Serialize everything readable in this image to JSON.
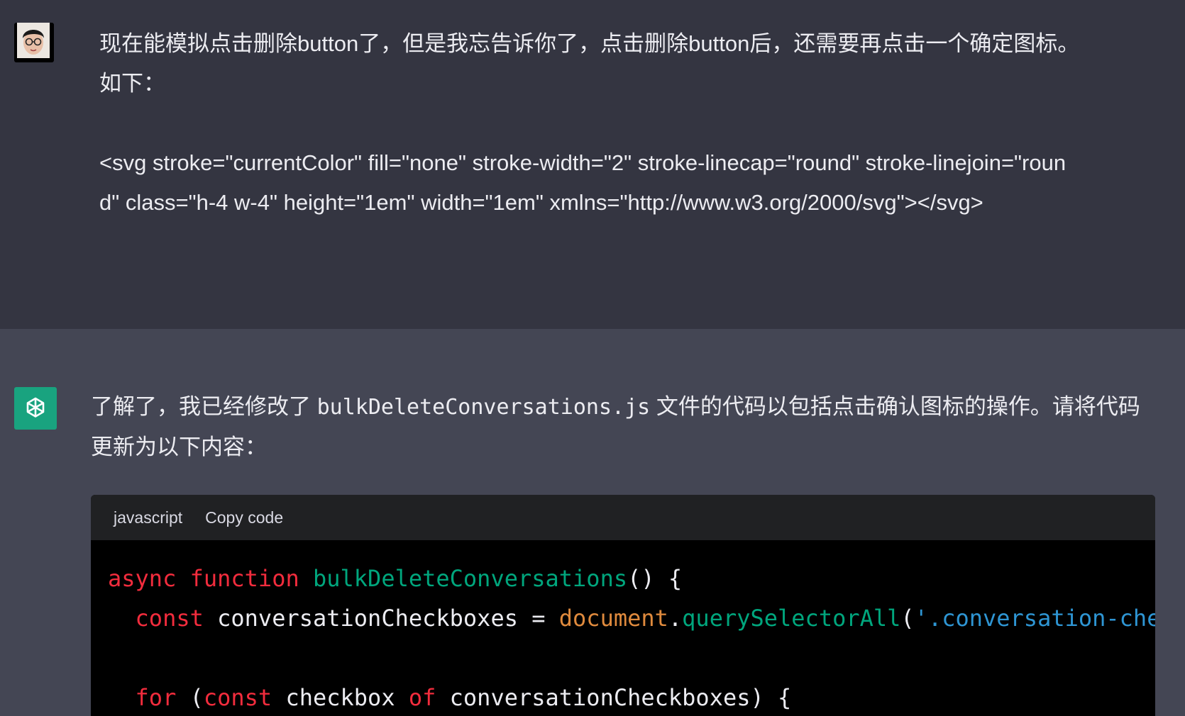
{
  "user_message": {
    "text": "现在能模拟点击删除button了，但是我忘告诉你了，点击删除button后，还需要再点击一个确定图标。如下：\n\n<svg stroke=\"currentColor\" fill=\"none\" stroke-width=\"2\" stroke-linecap=\"round\" stroke-linejoin=\"round\" class=\"h-4 w-4\" height=\"1em\" width=\"1em\" xmlns=\"http://www.w3.org/2000/svg\"></svg>"
  },
  "assistant_message": {
    "text_before": "了解了，我已经修改了 ",
    "filename": "bulkDeleteConversations.js",
    "text_after": " 文件的代码以包括点击确认图标的操作。请将代码更新为以下内容："
  },
  "code_block": {
    "language": "javascript",
    "copy_label": "Copy code",
    "lines": [
      [
        {
          "t": "kw",
          "v": "async"
        },
        {
          "t": "pl",
          "v": " "
        },
        {
          "t": "kw",
          "v": "function"
        },
        {
          "t": "pl",
          "v": " "
        },
        {
          "t": "fn",
          "v": "bulkDeleteConversations"
        },
        {
          "t": "pl",
          "v": "() {"
        }
      ],
      [
        {
          "t": "pl",
          "v": "  "
        },
        {
          "t": "kw",
          "v": "const"
        },
        {
          "t": "pl",
          "v": " conversationCheckboxes = "
        },
        {
          "t": "obj",
          "v": "document"
        },
        {
          "t": "pl",
          "v": "."
        },
        {
          "t": "fn",
          "v": "querySelectorAll"
        },
        {
          "t": "pl",
          "v": "("
        },
        {
          "t": "str",
          "v": "'.conversation-che"
        }
      ],
      [],
      [
        {
          "t": "pl",
          "v": "  "
        },
        {
          "t": "kw",
          "v": "for"
        },
        {
          "t": "pl",
          "v": " ("
        },
        {
          "t": "kw",
          "v": "const"
        },
        {
          "t": "pl",
          "v": " checkbox "
        },
        {
          "t": "kw",
          "v": "of"
        },
        {
          "t": "pl",
          "v": " conversationCheckboxes) {"
        }
      ]
    ]
  },
  "colors": {
    "user_bg": "#343541",
    "assistant_bg": "#444654",
    "bot_avatar": "#19a37f",
    "keyword": "#f22c3d",
    "function": "#00a67d",
    "object": "#df8a3d",
    "string": "#2e95d3"
  },
  "icons": {
    "user_avatar": "user-avatar-photo",
    "bot_avatar": "openai-logo-icon"
  }
}
